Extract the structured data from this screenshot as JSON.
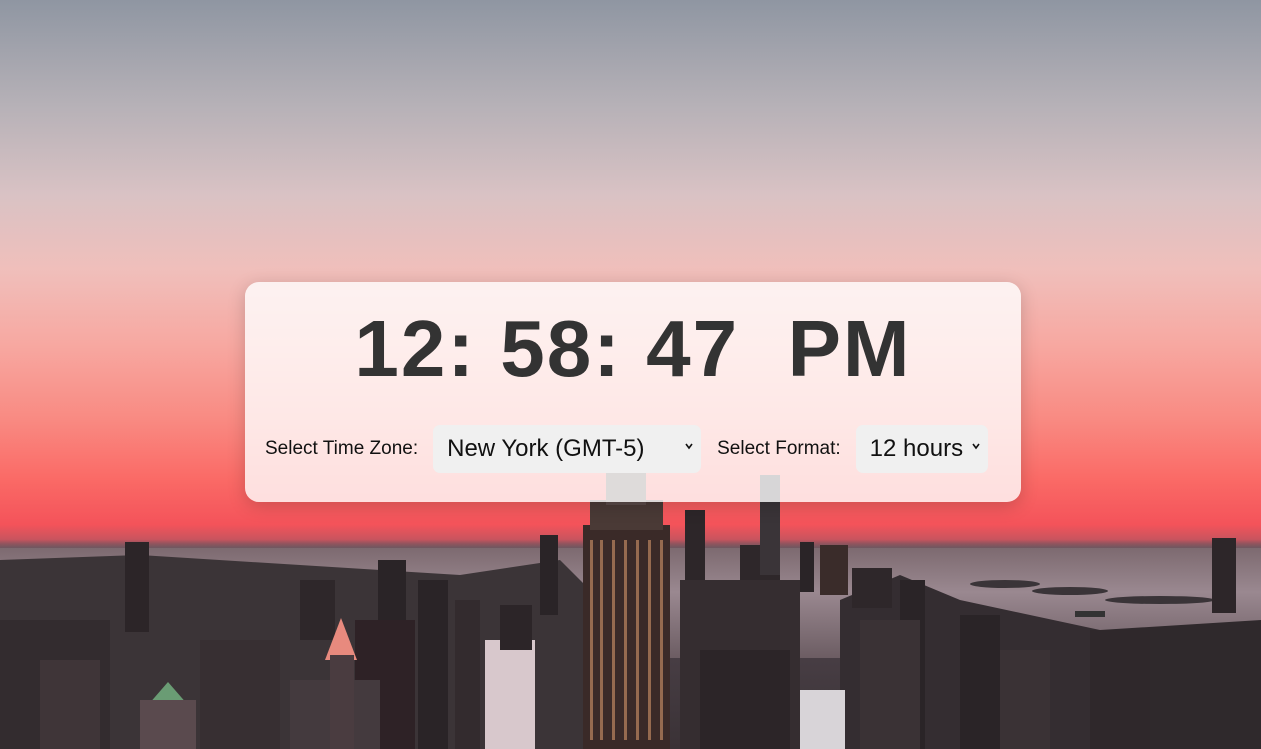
{
  "clock": {
    "time": "12: 58: 47  PM"
  },
  "timezone": {
    "label": "Select Time Zone:",
    "selected": "New York (GMT-5)"
  },
  "format": {
    "label": "Select Format:",
    "selected": "12 hours"
  },
  "icons": {
    "dropdown": "chevron-down-icon"
  }
}
